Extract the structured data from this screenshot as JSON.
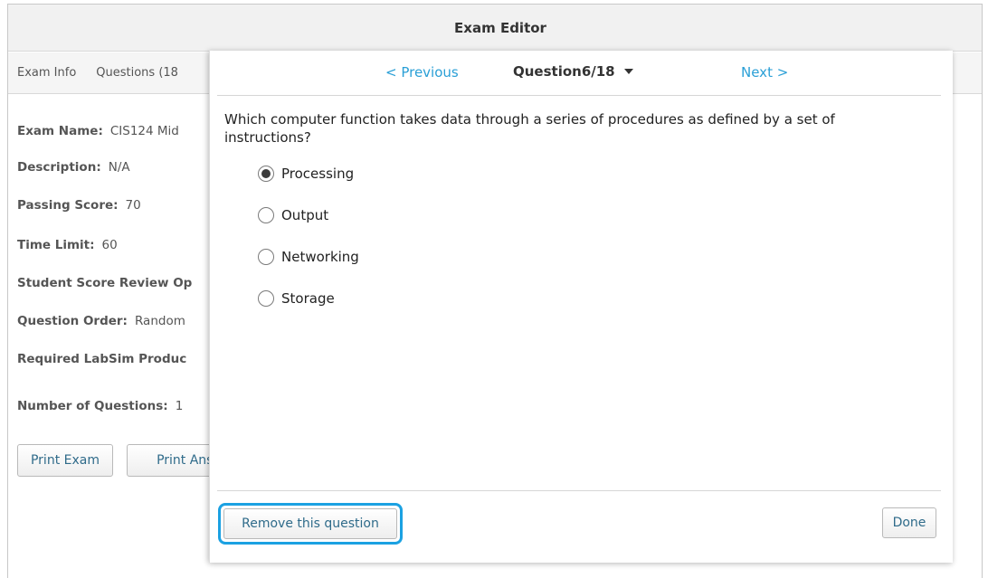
{
  "window": {
    "title": "Exam Editor"
  },
  "tabs": [
    {
      "label": "Exam Info"
    },
    {
      "label": "Questions (18"
    }
  ],
  "exam_info": {
    "exam_name": {
      "label": "Exam Name:",
      "value": "CIS124 Mid"
    },
    "description": {
      "label": "Description:",
      "value": "N/A"
    },
    "passing_score": {
      "label": "Passing Score:",
      "value": "70"
    },
    "time_limit": {
      "label": "Time Limit:",
      "value": "60"
    },
    "student_score_review": {
      "label": "Student Score Review Op",
      "value": ""
    },
    "question_order": {
      "label": "Question Order:",
      "value": "Random"
    },
    "required_labsim": {
      "label": "Required LabSim Produc",
      "value": ""
    },
    "number_of_questions": {
      "label": "Number of Questions:",
      "value": "1"
    }
  },
  "buttons": {
    "print_exam": "Print Exam",
    "print_answers": "Print Answ"
  },
  "modal": {
    "prev_label": "< Previous",
    "next_label": "Next >",
    "question_counter": "Question6/18",
    "question_text": "Which computer function takes data through a series of procedures as defined by a set of instructions?",
    "options": [
      {
        "label": "Processing",
        "selected": true
      },
      {
        "label": "Output",
        "selected": false
      },
      {
        "label": "Networking",
        "selected": false
      },
      {
        "label": "Storage",
        "selected": false
      }
    ],
    "remove_label": "Remove this question",
    "done_label": "Done"
  },
  "colors": {
    "link": "#2a9fd6",
    "highlight": "#1ba1e2",
    "button_text": "#2f6b8a"
  }
}
